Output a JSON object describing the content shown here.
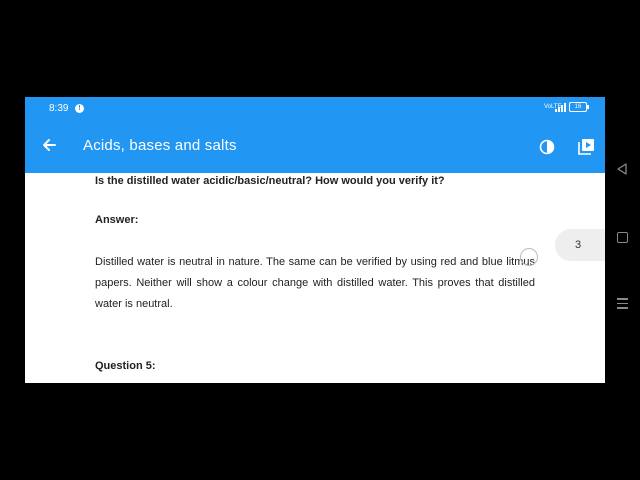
{
  "status_bar": {
    "time": "8:39",
    "notification_glyph": "!",
    "network_label": "VoLTE",
    "battery_level": "16"
  },
  "app_bar": {
    "title": "Acids, bases and salts",
    "back_icon": "arrow-left-icon",
    "actions": [
      "contrast-icon",
      "playlist-play-icon"
    ]
  },
  "content": {
    "question": "Is the distilled water acidic/basic/neutral? How would you verify it?",
    "answer_heading": "Answer:",
    "answer_body": "Distilled water is neutral in nature. The same can be verified by using red and blue litmus papers. Neither will show a colour change with distilled water. This proves that distilled water is neutral.",
    "next_question_heading": "Question 5:"
  },
  "page_indicator": "3",
  "system_nav": [
    "back-icon",
    "home-icon",
    "menu-icon"
  ],
  "colors": {
    "app_bar": "#2196f3",
    "background": "#ffffff",
    "letterbox": "#000000"
  }
}
